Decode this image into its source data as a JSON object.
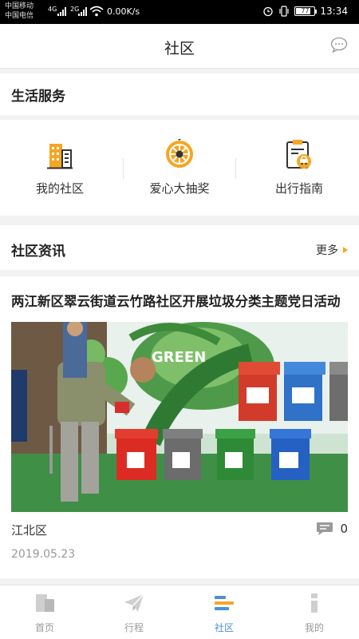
{
  "status_bar": {
    "carrier_1": "中国移动",
    "carrier_2": "中国电信",
    "net_1": "4G",
    "net_2": "2G",
    "speed": "0.00K/s",
    "battery": "77",
    "time": "13:34"
  },
  "header": {
    "title": "社区",
    "message_icon": "chat-bubble-icon"
  },
  "life_services": {
    "title": "生活服务",
    "items": [
      {
        "label": "我的社区",
        "icon": "building-icon"
      },
      {
        "label": "爱心大抽奖",
        "icon": "lottery-wheel-icon"
      },
      {
        "label": "出行指南",
        "icon": "car-guide-icon"
      }
    ]
  },
  "news": {
    "title": "社区资讯",
    "more_label": "更多",
    "articles": [
      {
        "title": "两江新区翠云街道云竹路社区开展垃圾分类主题党日活动",
        "district": "江北区",
        "comment_count": "0",
        "date": "2019.05.23",
        "image_text": "GREEN"
      }
    ]
  },
  "tabbar": {
    "tabs": [
      {
        "label": "首页",
        "icon": "home-icon"
      },
      {
        "label": "行程",
        "icon": "paper-plane-icon"
      },
      {
        "label": "社区",
        "icon": "community-icon"
      },
      {
        "label": "我的",
        "icon": "profile-icon"
      }
    ],
    "active_index": 2
  },
  "colors": {
    "accent_orange": "#f5a623",
    "active_blue": "#4a90d9",
    "inactive_gray": "#c8c8c8"
  }
}
